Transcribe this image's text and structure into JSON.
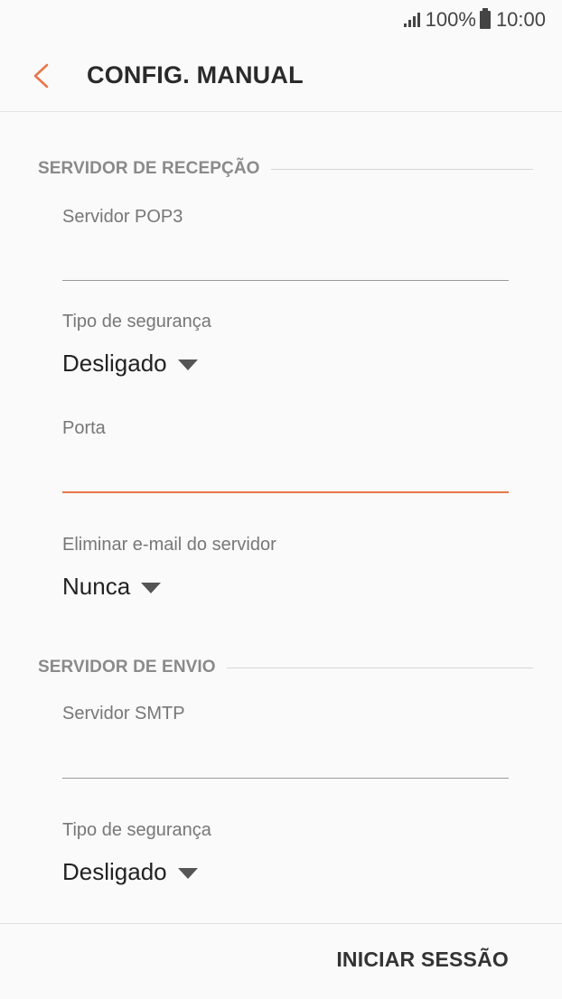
{
  "status_bar": {
    "battery": "100%",
    "time": "10:00"
  },
  "header": {
    "title": "CONFIG. MANUAL"
  },
  "incoming": {
    "section_title": "SERVIDOR DE RECEPÇÃO",
    "server_label": "Servidor POP3",
    "server_value": "",
    "security_label": "Tipo de segurança",
    "security_value": "Desligado",
    "port_label": "Porta",
    "port_value": "",
    "delete_label": "Eliminar e-mail do servidor",
    "delete_value": "Nunca"
  },
  "outgoing": {
    "section_title": "SERVIDOR DE ENVIO",
    "server_label": "Servidor SMTP",
    "server_value": "",
    "security_label": "Tipo de segurança",
    "security_value": "Desligado"
  },
  "footer": {
    "signin_label": "INICIAR SESSÃO"
  },
  "colors": {
    "accent": "#e8764a",
    "background": "#fafafa"
  }
}
